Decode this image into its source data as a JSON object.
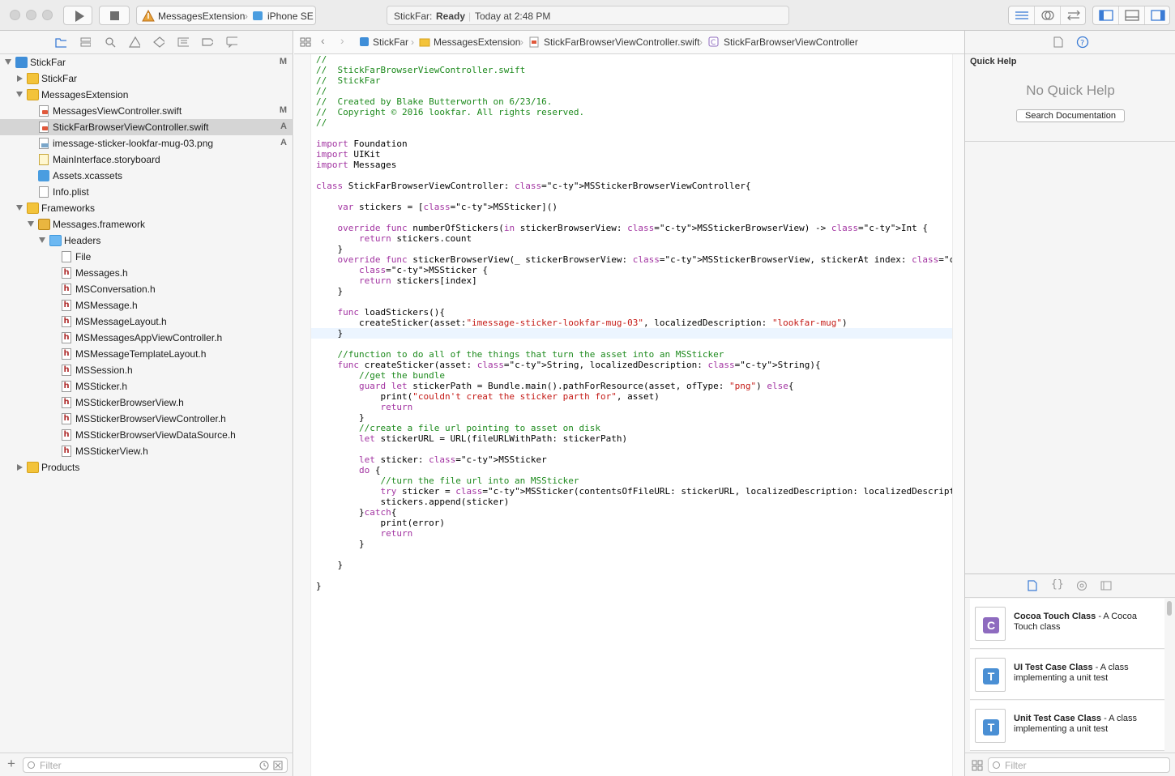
{
  "toolbar": {
    "scheme": "MessagesExtension",
    "device": "iPhone SE",
    "status_project": "StickFar:",
    "status_state": "Ready",
    "status_time": "Today at 2:48 PM"
  },
  "navigator": {
    "items": [
      {
        "label": "StickFar",
        "badge": "M"
      },
      {
        "label": "StickFar",
        "badge": ""
      },
      {
        "label": "MessagesExtension",
        "badge": ""
      },
      {
        "label": "MessagesViewController.swift",
        "badge": "M"
      },
      {
        "label": "StickFarBrowserViewController.swift",
        "badge": "A"
      },
      {
        "label": "imessage-sticker-lookfar-mug-03.png",
        "badge": "A"
      },
      {
        "label": "MainInterface.storyboard",
        "badge": ""
      },
      {
        "label": "Assets.xcassets",
        "badge": ""
      },
      {
        "label": "Info.plist",
        "badge": ""
      },
      {
        "label": "Frameworks",
        "badge": ""
      },
      {
        "label": "Messages.framework",
        "badge": ""
      },
      {
        "label": "Headers",
        "badge": ""
      },
      {
        "label": "File",
        "badge": ""
      },
      {
        "label": "Messages.h",
        "badge": ""
      },
      {
        "label": "MSConversation.h",
        "badge": ""
      },
      {
        "label": "MSMessage.h",
        "badge": ""
      },
      {
        "label": "MSMessageLayout.h",
        "badge": ""
      },
      {
        "label": "MSMessagesAppViewController.h",
        "badge": ""
      },
      {
        "label": "MSMessageTemplateLayout.h",
        "badge": ""
      },
      {
        "label": "MSSession.h",
        "badge": ""
      },
      {
        "label": "MSSticker.h",
        "badge": ""
      },
      {
        "label": "MSStickerBrowserView.h",
        "badge": ""
      },
      {
        "label": "MSStickerBrowserViewController.h",
        "badge": ""
      },
      {
        "label": "MSStickerBrowserViewDataSource.h",
        "badge": ""
      },
      {
        "label": "MSStickerView.h",
        "badge": ""
      },
      {
        "label": "Products",
        "badge": ""
      }
    ],
    "filter_placeholder": "Filter"
  },
  "jumpbar": {
    "crumbs": [
      "StickFar",
      "MessagesExtension",
      "StickFarBrowserViewController.swift",
      "StickFarBrowserViewController"
    ]
  },
  "editor": {
    "lines": [
      "//",
      "//  StickFarBrowserViewController.swift",
      "//  StickFar",
      "//",
      "//  Created by Blake Butterworth on 6/23/16.",
      "//  Copyright © 2016 lookfar. All rights reserved.",
      "//",
      "",
      "import Foundation",
      "import UIKit",
      "import Messages",
      "",
      "class StickFarBrowserViewController: MSStickerBrowserViewController{",
      "",
      "    var stickers = [MSSticker]()",
      "",
      "    override func numberOfStickers(in stickerBrowserView: MSStickerBrowserView) -> Int {",
      "        return stickers.count",
      "    }",
      "    override func stickerBrowserView(_ stickerBrowserView: MSStickerBrowserView, stickerAt index: Int) ->",
      "        MSSticker {",
      "        return stickers[index]",
      "    }",
      "",
      "    func loadStickers(){",
      "        createSticker(asset:\"imessage-sticker-lookfar-mug-03\", localizedDescription: \"lookfar-mug\")",
      "    }",
      "",
      "    //function to do all of the things that turn the asset into an MSSticker",
      "    func createSticker(asset: String, localizedDescription: String){",
      "        //get the bundle",
      "        guard let stickerPath = Bundle.main().pathForResource(asset, ofType: \"png\") else{",
      "            print(\"couldn't creat the sticker parth for\", asset)",
      "            return",
      "        }",
      "        //create a file url pointing to asset on disk",
      "        let stickerURL = URL(fileURLWithPath: stickerPath)",
      "",
      "        let sticker: MSSticker",
      "        do {",
      "            //turn the file url into an MSSticker",
      "            try sticker = MSSticker(contentsOfFileURL: stickerURL, localizedDescription: localizedDescription)",
      "            stickers.append(sticker)",
      "        }catch{",
      "            print(error)",
      "            return",
      "        }",
      "",
      "    }",
      "",
      "}"
    ]
  },
  "quick_help": {
    "title": "Quick Help",
    "empty_text": "No Quick Help",
    "search_button": "Search Documentation"
  },
  "library": {
    "items": [
      {
        "name": "Cocoa Touch Class",
        "desc": " - A Cocoa Touch class",
        "glyph": "C",
        "color": "#8e6bbf"
      },
      {
        "name": "UI Test Case Class",
        "desc": " - A class implementing a unit test",
        "glyph": "T",
        "color": "#4a8fd4"
      },
      {
        "name": "Unit Test Case Class",
        "desc": " - A class implementing a unit test",
        "glyph": "T",
        "color": "#4a8fd4"
      }
    ],
    "filter_placeholder": "Filter"
  }
}
